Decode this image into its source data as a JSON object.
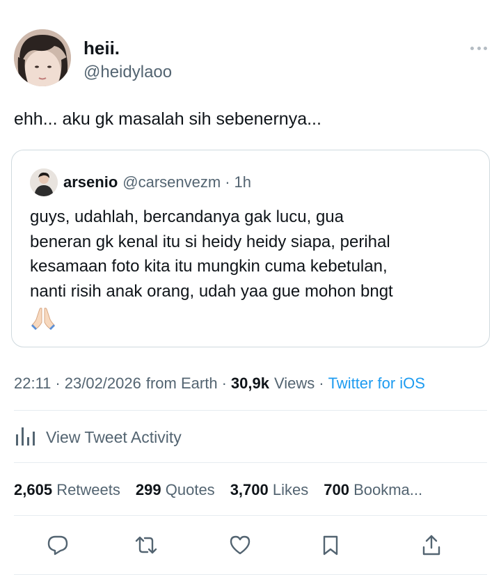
{
  "author": {
    "display_name": "heii.",
    "handle": "@heidylaoo",
    "avatar_icon": "avatar-photo"
  },
  "tweet": {
    "text": "ehh... aku gk masalah sih sebenernya..."
  },
  "quoted_tweet": {
    "display_name": "arsenio",
    "handle": "@carsenvezm",
    "separator": "·",
    "time": "1h",
    "text": "guys, udahlah, bercandanya gak lucu, gua\nbeneran gk kenal itu si heidy heidy siapa, perihal\nkesamaan foto kita itu mungkin cuma kebetulan,\nnanti risih anak orang, udah yaa gue mohon bngt",
    "emoji_icon": "folded-hands-emoji"
  },
  "meta": {
    "time": "22:11",
    "dot1": "·",
    "date": "23/02/2026",
    "from_text": "from Earth",
    "dot2": "·",
    "views_count": "30,9k",
    "views_label": "Views",
    "dot3": "·",
    "client": "Twitter for iOS"
  },
  "activity": {
    "label": "View Tweet Activity",
    "icon": "bar-chart-icon"
  },
  "stats": {
    "retweets_count": "2,605",
    "retweets_label": "Retweets",
    "quotes_count": "299",
    "quotes_label": "Quotes",
    "likes_count": "3,700",
    "likes_label": "Likes",
    "bookmarks_count": "700",
    "bookmarks_label": "Bookma..."
  },
  "actions": [
    "reply-icon",
    "retweet-icon",
    "like-icon",
    "bookmark-icon",
    "share-icon"
  ],
  "colors": {
    "text": "#0f1419",
    "secondary": "#536471",
    "link": "#1d9bf0",
    "border": "#cfd9de",
    "divider": "#e6ecf0"
  }
}
